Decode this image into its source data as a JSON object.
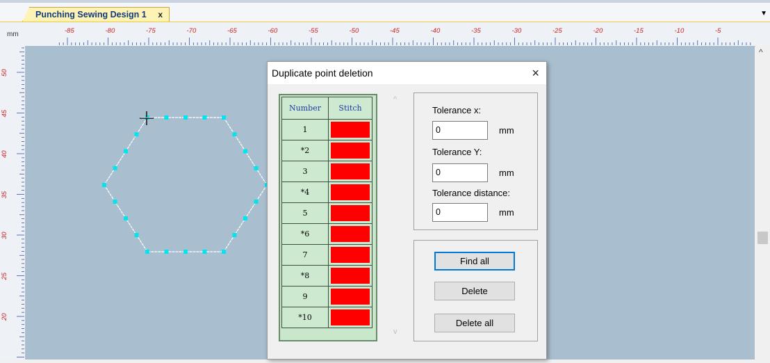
{
  "tab": {
    "title": "Punching Sewing Design 1",
    "close": "x",
    "menu_arrow": "▼"
  },
  "ruler": {
    "unit": "mm",
    "top_labels": [
      "-85",
      "-80",
      "-75",
      "-70",
      "-65",
      "-60",
      "-55",
      "-50",
      "-45",
      "-40",
      "-35",
      "-30",
      "-25",
      "-20",
      "-15",
      "-10",
      "-5"
    ],
    "left_labels": [
      "50",
      "45",
      "40",
      "35",
      "30",
      "25",
      "20"
    ]
  },
  "scrollbar": {
    "up": "^"
  },
  "dialog": {
    "title": "Duplicate point deletion",
    "close": "×",
    "table": {
      "headers": [
        "Number",
        "Stitch"
      ],
      "rows": [
        "1",
        "*2",
        "3",
        "*4",
        "5",
        "*6",
        "7",
        "*8",
        "9",
        "*10"
      ],
      "stitch_color": "#ff0000"
    },
    "list_scroll": {
      "up": "^",
      "down": "v"
    },
    "tolerance_x_label": "Tolerance x:",
    "tolerance_x_value": "0",
    "tolerance_y_label": "Tolerance Y:",
    "tolerance_y_value": "0",
    "tolerance_distance_label": "Tolerance distance:",
    "tolerance_distance_value": "0",
    "unit": "mm",
    "find_all": "Find all",
    "delete": "Delete",
    "delete_all": "Delete all"
  },
  "colors": {
    "canvas": "#a9bfcf",
    "points": "#00e5ee",
    "outline": "#ffffff",
    "ruler_labels": "#cc2222"
  }
}
